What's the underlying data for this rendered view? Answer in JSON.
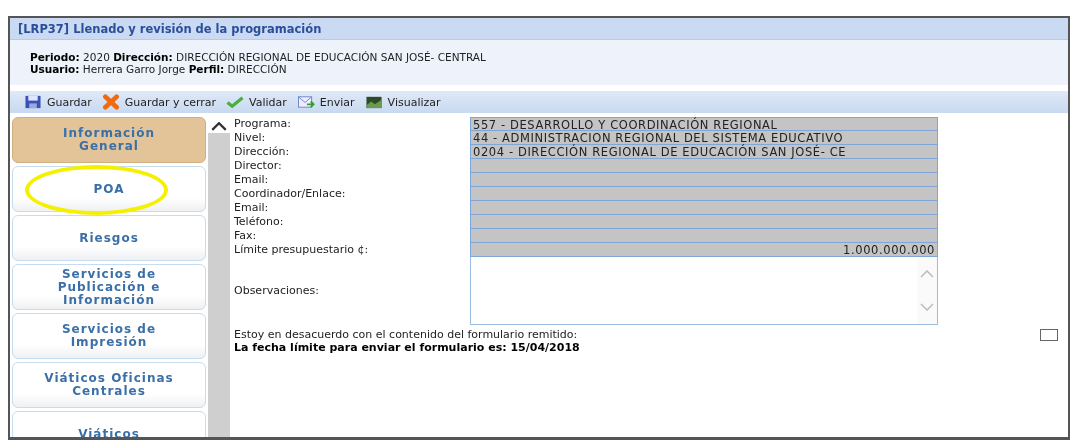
{
  "window": {
    "title": "[LRP37] Llenado y revisión de la programación"
  },
  "header": {
    "lines": [
      "**Periodo:** 2020 **Dirección:** DIRECCIÓN REGIONAL DE EDUCACIÓN SAN JOSÉ- CENTRAL",
      "**Usuario:** Herrera Garro Jorge **Perfil:** DIRECCIÓN"
    ]
  },
  "toolbar": [
    {
      "kind": "save",
      "label": "Guardar"
    },
    {
      "kind": "save_close",
      "label": "Guardar y cerrar"
    },
    {
      "kind": "validate",
      "label": "Validar"
    },
    {
      "kind": "send",
      "label": "Enviar"
    },
    {
      "kind": "view",
      "label": "Visualizar"
    }
  ],
  "sidebar": {
    "items": [
      {
        "label": "Información General",
        "selected": true,
        "circled": false
      },
      {
        "label": "POA",
        "selected": false,
        "circled": true
      },
      {
        "label": "Riesgos",
        "selected": false,
        "circled": false
      },
      {
        "label": "Servicios de Publicación e Información",
        "selected": false,
        "circled": false
      },
      {
        "label": "Servicios de Impresión",
        "selected": false,
        "circled": false
      },
      {
        "label": "Viáticos Oficinas Centrales",
        "selected": false,
        "circled": false
      },
      {
        "label": "Viáticos",
        "selected": false,
        "circled": false
      }
    ]
  },
  "form": {
    "fields": [
      {
        "kind": "text",
        "label": "Programa:",
        "value": "557 - DESARROLLO Y COORDINACIÓN REGIONAL",
        "disabled": true
      },
      {
        "kind": "text",
        "label": "Nivel:",
        "value": "44 - ADMINISTRACION REGIONAL DEL SISTEMA EDUCATIVO",
        "disabled": true
      },
      {
        "kind": "text",
        "label": "Dirección:",
        "value": "0204 - DIRECCIÓN REGIONAL DE EDUCACIÓN SAN JOSÉ- CE",
        "disabled": true
      },
      {
        "kind": "text",
        "label": "Director:",
        "disabled": true
      },
      {
        "kind": "text",
        "label": "Email:",
        "disabled": true
      },
      {
        "kind": "text",
        "label": "Coordinador/Enlace:",
        "disabled": true
      },
      {
        "kind": "text",
        "label": "Email:",
        "disabled": true
      },
      {
        "kind": "text",
        "label": "Teléfono:",
        "disabled": true
      },
      {
        "kind": "text",
        "label": "Fax:",
        "disabled": true
      },
      {
        "kind": "amount",
        "label": "Límite presupuestario ¢:",
        "value": "1.000.000.000",
        "disabled": true
      },
      {
        "kind": "textarea",
        "label": "Observaciones:",
        "disabled": false
      }
    ],
    "disagree": {
      "label": "Estoy en desacuerdo con el contenido del formulario remitido:",
      "checked": false
    },
    "deadline": "La fecha límite para enviar el formulario es: 15/04/2018"
  }
}
